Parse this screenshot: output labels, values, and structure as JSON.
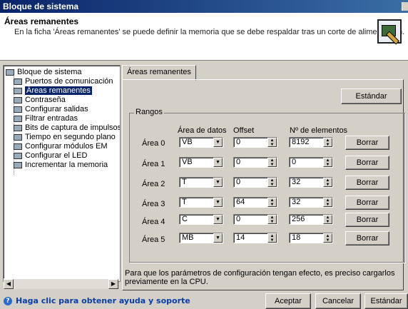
{
  "window": {
    "title": "Bloque de sistema"
  },
  "header": {
    "title": "Áreas remanentes",
    "description": "En la ficha 'Áreas remanentes' se puede definir la memoria que se debe respaldar tras un corte de alimentación.",
    "icon": "memory-config-icon"
  },
  "tree": {
    "root": "Bloque de sistema",
    "items": [
      "Puertos de comunicación",
      "Áreas remanentes",
      "Contraseña",
      "Configurar salidas",
      "Filtrar entradas",
      "Bits de captura de impulsos",
      "Tiempo en segundo plano",
      "Configurar módulos EM",
      "Configurar el LED",
      "Incrementar la memoria"
    ],
    "selected_index": 1
  },
  "tabs": [
    "Áreas remanentes"
  ],
  "buttons": {
    "estandar_top": "Estándar",
    "aceptar": "Aceptar",
    "cancelar": "Cancelar",
    "estandar_bottom": "Estándar"
  },
  "group": {
    "legend": "Rangos",
    "col_area": "Área de datos",
    "col_offset": "Offset",
    "col_elements": "Nº de elementos",
    "rows": [
      {
        "label": "Área 0",
        "area": "VB",
        "offset": "0",
        "elements": "8192",
        "button": "Borrar"
      },
      {
        "label": "Área 1",
        "area": "VB",
        "offset": "0",
        "elements": "0",
        "button": "Borrar"
      },
      {
        "label": "Área 2",
        "area": "T",
        "offset": "0",
        "elements": "32",
        "button": "Borrar"
      },
      {
        "label": "Área 3",
        "area": "T",
        "offset": "64",
        "elements": "32",
        "button": "Borrar"
      },
      {
        "label": "Área 4",
        "area": "C",
        "offset": "0",
        "elements": "256",
        "button": "Borrar"
      },
      {
        "label": "Área 5",
        "area": "MB",
        "offset": "14",
        "elements": "18",
        "button": "Borrar"
      }
    ]
  },
  "note": "Para que los parámetros de configuración tengan efecto, es preciso cargarlos previamente en la CPU.",
  "help": {
    "text": "Haga clic para obtener ayuda y soporte",
    "icon": "help-icon"
  }
}
